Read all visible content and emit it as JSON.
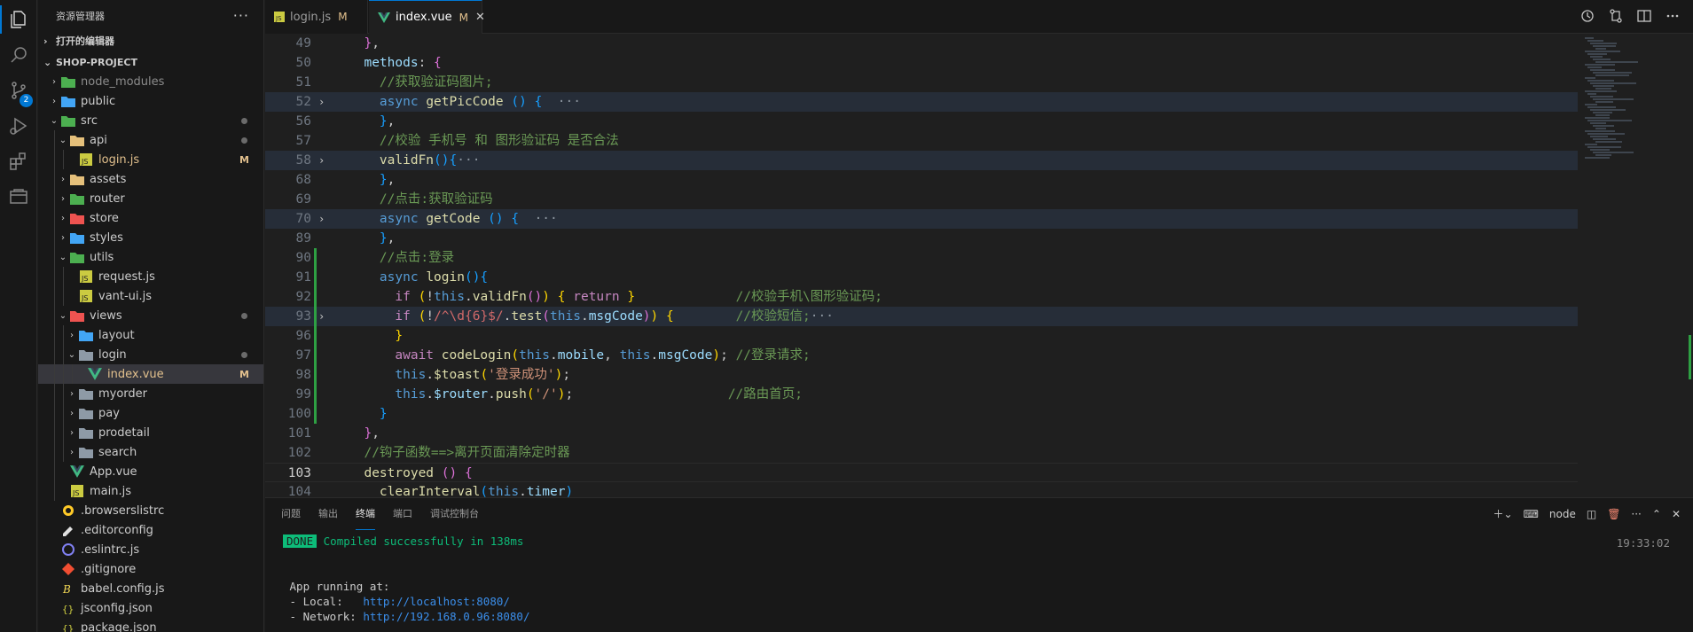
{
  "explorer": {
    "title": "资源管理器",
    "more": "···",
    "open_editors": "打开的编辑器",
    "project": "SHOP-PROJECT",
    "tree": [
      {
        "depth": 0,
        "type": "folder",
        "open": false,
        "name": "node_modules",
        "icon": "folder-green",
        "dim": true
      },
      {
        "depth": 0,
        "type": "folder",
        "open": false,
        "name": "public",
        "icon": "folder-blue"
      },
      {
        "depth": 0,
        "type": "folder",
        "open": true,
        "name": "src",
        "icon": "folder-green",
        "dot": true
      },
      {
        "depth": 1,
        "type": "folder",
        "open": true,
        "name": "api",
        "icon": "folder-yellow",
        "dot": true
      },
      {
        "depth": 2,
        "type": "file",
        "name": "login.js",
        "icon": "js",
        "mod": "M"
      },
      {
        "depth": 1,
        "type": "folder",
        "open": false,
        "name": "assets",
        "icon": "folder-yellow"
      },
      {
        "depth": 1,
        "type": "folder",
        "open": false,
        "name": "router",
        "icon": "folder-green"
      },
      {
        "depth": 1,
        "type": "folder",
        "open": false,
        "name": "store",
        "icon": "folder-red"
      },
      {
        "depth": 1,
        "type": "folder",
        "open": false,
        "name": "styles",
        "icon": "folder-blue"
      },
      {
        "depth": 1,
        "type": "folder",
        "open": true,
        "name": "utils",
        "icon": "folder-green"
      },
      {
        "depth": 2,
        "type": "file",
        "name": "request.js",
        "icon": "js"
      },
      {
        "depth": 2,
        "type": "file",
        "name": "vant-ui.js",
        "icon": "js"
      },
      {
        "depth": 1,
        "type": "folder",
        "open": true,
        "name": "views",
        "icon": "folder-red",
        "dot": true
      },
      {
        "depth": 2,
        "type": "folder",
        "open": false,
        "name": "layout",
        "icon": "folder-blue"
      },
      {
        "depth": 2,
        "type": "folder",
        "open": true,
        "name": "login",
        "icon": "folder-plain",
        "dot": true
      },
      {
        "depth": 3,
        "type": "file",
        "name": "index.vue",
        "icon": "vue",
        "mod": "M",
        "selected": true
      },
      {
        "depth": 2,
        "type": "folder",
        "open": false,
        "name": "myorder",
        "icon": "folder-plain"
      },
      {
        "depth": 2,
        "type": "folder",
        "open": false,
        "name": "pay",
        "icon": "folder-plain"
      },
      {
        "depth": 2,
        "type": "folder",
        "open": false,
        "name": "prodetail",
        "icon": "folder-plain"
      },
      {
        "depth": 2,
        "type": "folder",
        "open": false,
        "name": "search",
        "icon": "folder-plain"
      },
      {
        "depth": 1,
        "type": "file",
        "name": "App.vue",
        "icon": "vue"
      },
      {
        "depth": 1,
        "type": "file",
        "name": "main.js",
        "icon": "js"
      },
      {
        "depth": 0,
        "type": "file",
        "name": ".browserslistrc",
        "icon": "browserslist"
      },
      {
        "depth": 0,
        "type": "file",
        "name": ".editorconfig",
        "icon": "editorconfig"
      },
      {
        "depth": 0,
        "type": "file",
        "name": ".eslintrc.js",
        "icon": "eslint"
      },
      {
        "depth": 0,
        "type": "file",
        "name": ".gitignore",
        "icon": "git"
      },
      {
        "depth": 0,
        "type": "file",
        "name": "babel.config.js",
        "icon": "babel"
      },
      {
        "depth": 0,
        "type": "file",
        "name": "jsconfig.json",
        "icon": "json"
      },
      {
        "depth": 0,
        "type": "file",
        "name": "package.json",
        "icon": "json"
      }
    ]
  },
  "tabs": [
    {
      "label": "login.js",
      "mod": "M",
      "icon": "js",
      "active": false
    },
    {
      "label": "index.vue",
      "mod": "M",
      "icon": "vue",
      "active": true,
      "close": "✕"
    }
  ],
  "scm_badge": "2",
  "editor": {
    "lines": [
      {
        "n": "49",
        "fold": "",
        "hl": false,
        "git": false,
        "tokens": [
          [
            "pn",
            "  "
          ],
          [
            "br2",
            "}"
          ],
          [
            "pn",
            ","
          ]
        ]
      },
      {
        "n": "50",
        "fold": "",
        "hl": false,
        "git": false,
        "tokens": [
          [
            "pn",
            "  "
          ],
          [
            "vr",
            "methods"
          ],
          [
            "pn",
            ": "
          ],
          [
            "br2",
            "{"
          ]
        ]
      },
      {
        "n": "51",
        "fold": "",
        "hl": false,
        "git": false,
        "tokens": [
          [
            "pn",
            "    "
          ],
          [
            "cm",
            "//获取验证码图片;"
          ]
        ]
      },
      {
        "n": "52",
        "fold": "›",
        "hl": true,
        "git": false,
        "tokens": [
          [
            "pn",
            "    "
          ],
          [
            "kw",
            "async "
          ],
          [
            "fn",
            "getPicCode"
          ],
          [
            "pn",
            " "
          ],
          [
            "br3",
            "()"
          ],
          [
            "pn",
            " "
          ],
          [
            "br3",
            "{"
          ],
          [
            "pn",
            "  "
          ],
          [
            "fold-dots",
            "···"
          ]
        ]
      },
      {
        "n": "56",
        "fold": "",
        "hl": false,
        "git": false,
        "tokens": [
          [
            "pn",
            "    "
          ],
          [
            "br3",
            "}"
          ],
          [
            "pn",
            ","
          ]
        ]
      },
      {
        "n": "57",
        "fold": "",
        "hl": false,
        "git": false,
        "tokens": [
          [
            "pn",
            "    "
          ],
          [
            "cm",
            "//校验 手机号 和 图形验证码 是否合法"
          ]
        ]
      },
      {
        "n": "58",
        "fold": "›",
        "hl": true,
        "git": false,
        "tokens": [
          [
            "pn",
            "    "
          ],
          [
            "fn",
            "validFn"
          ],
          [
            "br3",
            "(){"
          ],
          [
            "fold-dots",
            "···"
          ]
        ]
      },
      {
        "n": "68",
        "fold": "",
        "hl": false,
        "git": false,
        "tokens": [
          [
            "pn",
            "    "
          ],
          [
            "br3",
            "}"
          ],
          [
            "pn",
            ","
          ]
        ]
      },
      {
        "n": "69",
        "fold": "",
        "hl": false,
        "git": false,
        "tokens": [
          [
            "pn",
            "    "
          ],
          [
            "cm",
            "//点击:获取验证码"
          ]
        ]
      },
      {
        "n": "70",
        "fold": "›",
        "hl": true,
        "git": false,
        "tokens": [
          [
            "pn",
            "    "
          ],
          [
            "kw",
            "async "
          ],
          [
            "fn",
            "getCode"
          ],
          [
            "pn",
            " "
          ],
          [
            "br3",
            "()"
          ],
          [
            "pn",
            " "
          ],
          [
            "br3",
            "{"
          ],
          [
            "pn",
            "  "
          ],
          [
            "fold-dots",
            "···"
          ]
        ]
      },
      {
        "n": "89",
        "fold": "",
        "hl": false,
        "git": false,
        "tokens": [
          [
            "pn",
            "    "
          ],
          [
            "br3",
            "}"
          ],
          [
            "pn",
            ","
          ]
        ]
      },
      {
        "n": "90",
        "fold": "",
        "hl": false,
        "git": true,
        "tokens": [
          [
            "pn",
            "    "
          ],
          [
            "cm",
            "//点击:登录"
          ]
        ]
      },
      {
        "n": "91",
        "fold": "",
        "hl": false,
        "git": true,
        "tokens": [
          [
            "pn",
            "    "
          ],
          [
            "kw",
            "async "
          ],
          [
            "fn",
            "login"
          ],
          [
            "br3",
            "(){"
          ]
        ]
      },
      {
        "n": "92",
        "fold": "",
        "hl": false,
        "git": true,
        "tokens": [
          [
            "pn",
            "      "
          ],
          [
            "ctl",
            "if "
          ],
          [
            "br1",
            "("
          ],
          [
            "pn",
            "!"
          ],
          [
            "kw",
            "this"
          ],
          [
            "pn",
            "."
          ],
          [
            "fn",
            "validFn"
          ],
          [
            "br2",
            "()"
          ],
          [
            "br1",
            ")"
          ],
          [
            "pn",
            " "
          ],
          [
            "br1",
            "{"
          ],
          [
            "pn",
            " "
          ],
          [
            "ctl",
            "return"
          ],
          [
            "pn",
            " "
          ],
          [
            "br1",
            "}"
          ],
          [
            "pn",
            "             "
          ],
          [
            "cm",
            "//校验手机\\图形验证码;"
          ]
        ]
      },
      {
        "n": "93",
        "fold": "›",
        "hl": true,
        "git": true,
        "tokens": [
          [
            "pn",
            "      "
          ],
          [
            "ctl",
            "if "
          ],
          [
            "br1",
            "("
          ],
          [
            "pn",
            "!"
          ],
          [
            "rx",
            "/^\\d{6}$/"
          ],
          [
            "pn",
            "."
          ],
          [
            "fn",
            "test"
          ],
          [
            "br2",
            "("
          ],
          [
            "kw",
            "this"
          ],
          [
            "pn",
            "."
          ],
          [
            "vr",
            "msgCode"
          ],
          [
            "br2",
            ")"
          ],
          [
            "br1",
            ")"
          ],
          [
            "pn",
            " "
          ],
          [
            "br1",
            "{"
          ],
          [
            "pn",
            "        "
          ],
          [
            "cm",
            "//校验短信;"
          ],
          [
            "fold-dots",
            "···"
          ]
        ]
      },
      {
        "n": "96",
        "fold": "",
        "hl": false,
        "git": true,
        "tokens": [
          [
            "pn",
            "      "
          ],
          [
            "br1",
            "}"
          ]
        ]
      },
      {
        "n": "97",
        "fold": "",
        "hl": false,
        "git": true,
        "tokens": [
          [
            "pn",
            "      "
          ],
          [
            "ctl",
            "await "
          ],
          [
            "fn",
            "codeLogin"
          ],
          [
            "br1",
            "("
          ],
          [
            "kw",
            "this"
          ],
          [
            "pn",
            "."
          ],
          [
            "vr",
            "mobile"
          ],
          [
            "pn",
            ", "
          ],
          [
            "kw",
            "this"
          ],
          [
            "pn",
            "."
          ],
          [
            "vr",
            "msgCode"
          ],
          [
            "br1",
            ")"
          ],
          [
            "pn",
            "; "
          ],
          [
            "cm",
            "//登录请求;"
          ]
        ]
      },
      {
        "n": "98",
        "fold": "",
        "hl": false,
        "git": true,
        "tokens": [
          [
            "pn",
            "      "
          ],
          [
            "kw",
            "this"
          ],
          [
            "pn",
            "."
          ],
          [
            "fn",
            "$toast"
          ],
          [
            "br1",
            "("
          ],
          [
            "st",
            "'登录成功'"
          ],
          [
            "br1",
            ")"
          ],
          [
            "pn",
            ";"
          ]
        ]
      },
      {
        "n": "99",
        "fold": "",
        "hl": false,
        "git": true,
        "tokens": [
          [
            "pn",
            "      "
          ],
          [
            "kw",
            "this"
          ],
          [
            "pn",
            "."
          ],
          [
            "vr",
            "$router"
          ],
          [
            "pn",
            "."
          ],
          [
            "fn",
            "push"
          ],
          [
            "br1",
            "("
          ],
          [
            "st",
            "'/'"
          ],
          [
            "br1",
            ")"
          ],
          [
            "pn",
            ";                    "
          ],
          [
            "cm",
            "//路由首页;"
          ]
        ]
      },
      {
        "n": "100",
        "fold": "",
        "hl": false,
        "git": true,
        "tokens": [
          [
            "pn",
            "    "
          ],
          [
            "br3",
            "}"
          ]
        ]
      },
      {
        "n": "101",
        "fold": "",
        "hl": false,
        "git": false,
        "tokens": [
          [
            "pn",
            "  "
          ],
          [
            "br2",
            "}"
          ],
          [
            "pn",
            ","
          ]
        ]
      },
      {
        "n": "102",
        "fold": "",
        "hl": false,
        "git": false,
        "tokens": [
          [
            "pn",
            "  "
          ],
          [
            "cm",
            "//钩子函数==>离开页面清除定时器"
          ]
        ]
      },
      {
        "n": "103",
        "fold": "",
        "hl": false,
        "git": false,
        "current": true,
        "tokens": [
          [
            "pn",
            "  "
          ],
          [
            "fn",
            "destroyed"
          ],
          [
            "pn",
            " "
          ],
          [
            "br2",
            "()"
          ],
          [
            "pn",
            " "
          ],
          [
            "br2",
            "{"
          ]
        ]
      },
      {
        "n": "104",
        "fold": "",
        "hl": false,
        "git": false,
        "tokens": [
          [
            "pn",
            "    "
          ],
          [
            "fn",
            "clearInterval"
          ],
          [
            "br3",
            "("
          ],
          [
            "kw",
            "this"
          ],
          [
            "pn",
            "."
          ],
          [
            "vr",
            "timer"
          ],
          [
            "br3",
            ")"
          ]
        ]
      }
    ]
  },
  "panel": {
    "tabs": [
      "问题",
      "输出",
      "终端",
      "端口",
      "调试控制台"
    ],
    "active_tab": "终端",
    "shell": "node",
    "done": "DONE",
    "compiled": "Compiled successfully in 138ms",
    "time": "19:33:02",
    "running": "App running at:",
    "local_label": "- Local:   ",
    "local_url": "http://localhost:8080/",
    "network_label": "- Network: ",
    "network_url": "http://192.168.0.96:8080/"
  },
  "colors": {
    "accent": "#0078d4",
    "modified": "#e2c08d",
    "git_added": "#2ea043",
    "done_bg": "#0dbc79"
  }
}
